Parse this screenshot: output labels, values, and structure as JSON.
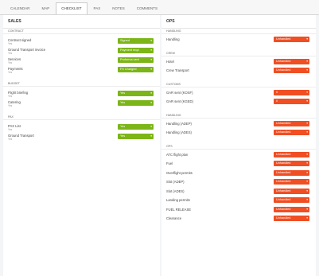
{
  "tabs": [
    "CALENDAR",
    "MAP",
    "CHECKLIST",
    "PAX",
    "NOTES",
    "COMMENTS"
  ],
  "active_tab": 2,
  "sales": {
    "title": "SALES",
    "sections": [
      {
        "label": "CONTRACT",
        "rows": [
          {
            "label": "Contract signed",
            "sub": "Yes",
            "value": "Signed"
          },
          {
            "label": "Ground Transport invoice",
            "sub": "Yes",
            "value": "Payment reqd"
          },
          {
            "label": "Services",
            "sub": "Yes",
            "value": "Proforma sent"
          },
          {
            "label": "Payments",
            "sub": "Yes",
            "value": "FX Charged"
          }
        ]
      },
      {
        "label": "BUDGET",
        "rows": [
          {
            "label": "Flight briefing",
            "sub": "Yes",
            "value": "Yes"
          },
          {
            "label": "Catering",
            "sub": "Yes",
            "value": "Yes"
          }
        ]
      },
      {
        "label": "PAX",
        "rows": [
          {
            "label": "PAX List",
            "sub": "Yes",
            "value": "Yes"
          },
          {
            "label": "Ground Transport",
            "sub": "Yes",
            "value": "Yes"
          }
        ]
      }
    ]
  },
  "ops": {
    "title": "OPS",
    "sections": [
      {
        "label": "HANDLING",
        "rows": [
          {
            "label": "Handling",
            "value": "Unhandled"
          }
        ]
      },
      {
        "label": "CREW",
        "rows": [
          {
            "label": "Hotel",
            "value": "Unhandled"
          },
          {
            "label": "Crew Transport",
            "value": "Unhandled"
          }
        ]
      },
      {
        "label": "CUSTOMS",
        "rows": [
          {
            "label": "GAR sent (KOSF)",
            "value": "0"
          },
          {
            "label": "GAR sent (KGED)",
            "value": "0"
          }
        ]
      },
      {
        "label": "HANDLING",
        "rows": [
          {
            "label": "Handling (ADEP)",
            "value": "Unhandled"
          },
          {
            "label": "Handling (ADES)",
            "value": "Unhandled"
          }
        ]
      },
      {
        "label": "OPS",
        "rows": [
          {
            "label": "ATC flight plan",
            "value": "Unhandled"
          },
          {
            "label": "Fuel",
            "value": "Unhandled"
          },
          {
            "label": "Overflight permits",
            "value": "Unhandled"
          },
          {
            "label": "Slot (ADEP)",
            "value": "Unhandled"
          },
          {
            "label": "Slot (ADES)",
            "value": "Unhandled"
          },
          {
            "label": "Landing permits",
            "value": "Unhandled"
          },
          {
            "label": "FUEL RELEASE",
            "value": "Unhandled"
          },
          {
            "label": "Clearance",
            "value": "Unhandled"
          }
        ]
      }
    ]
  }
}
